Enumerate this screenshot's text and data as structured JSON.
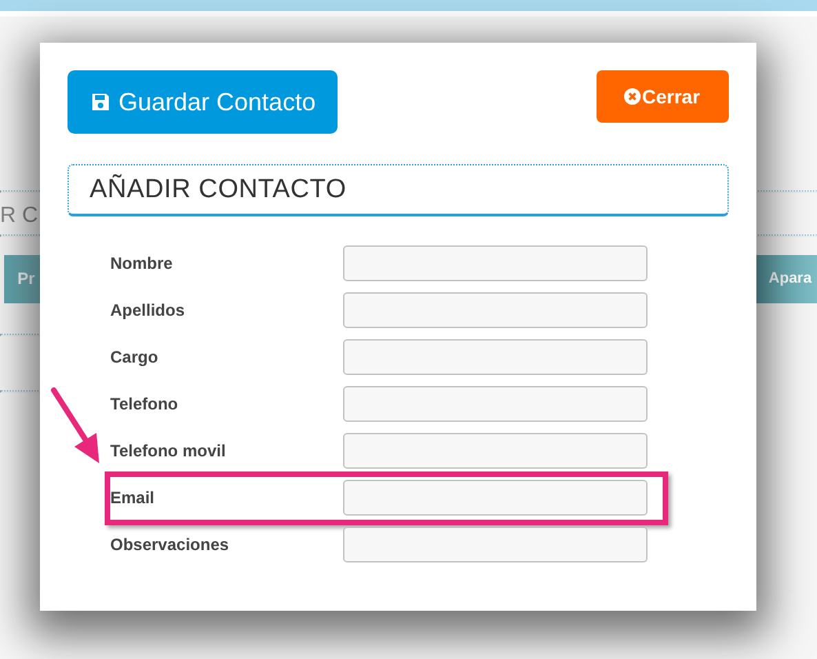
{
  "background": {
    "heading": "R C",
    "tabs": [
      {
        "label": "Pr"
      },
      {
        "label": "Apara"
      }
    ]
  },
  "modal": {
    "save_button": "Guardar Contacto",
    "close_button": "Cerrar",
    "title": "AÑADIR CONTACTO",
    "fields": [
      {
        "label": "Nombre",
        "highlighted": false
      },
      {
        "label": "Apellidos",
        "highlighted": false
      },
      {
        "label": "Cargo",
        "highlighted": false
      },
      {
        "label": "Telefono",
        "highlighted": false
      },
      {
        "label": "Telefono movil",
        "highlighted": false
      },
      {
        "label": "Email",
        "highlighted": true
      },
      {
        "label": "Observaciones",
        "highlighted": false
      }
    ]
  }
}
